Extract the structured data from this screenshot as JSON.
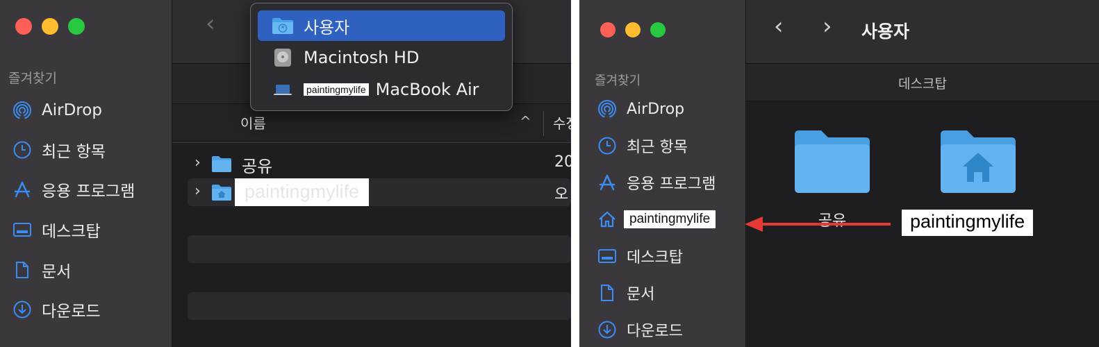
{
  "left": {
    "sidebar": {
      "section_title": "즐겨찾기",
      "items": [
        {
          "label": "AirDrop",
          "icon": "airdrop-icon"
        },
        {
          "label": "최근 항목",
          "icon": "clock-icon"
        },
        {
          "label": "응용 프로그램",
          "icon": "applications-icon"
        },
        {
          "label": "데스크탑",
          "icon": "desktop-icon"
        },
        {
          "label": "문서",
          "icon": "document-icon"
        },
        {
          "label": "다운로드",
          "icon": "download-icon"
        }
      ]
    },
    "toolbar": {
      "back": "‹"
    },
    "path_menu": {
      "items": [
        {
          "label": "사용자",
          "icon": "users-folder-icon",
          "selected": true
        },
        {
          "label": "Macintosh HD",
          "icon": "hard-drive-icon",
          "selected": false
        },
        {
          "label": "MacBook Air",
          "owner_redacted": "paintingmylife",
          "icon": "laptop-icon",
          "selected": false
        }
      ]
    },
    "columns": {
      "name": "이름",
      "sort_indicator": "^",
      "date": "수정일"
    },
    "rows": [
      {
        "expander": "›",
        "name": "공유",
        "modified": "20",
        "icon": "folder-icon"
      },
      {
        "expander": "›",
        "name": "paintingmylife",
        "modified": "오",
        "icon": "home-folder-icon"
      }
    ]
  },
  "right": {
    "toolbar": {
      "back": "‹",
      "forward": "›",
      "title": "사용자"
    },
    "path": "데스크탑",
    "sidebar": {
      "section_title": "즐겨찾기",
      "items": [
        {
          "label": "AirDrop",
          "icon": "airdrop-icon"
        },
        {
          "label": "최근 항목",
          "icon": "clock-icon"
        },
        {
          "label": "응용 프로그램",
          "icon": "applications-icon"
        },
        {
          "label": "paintingmylife",
          "icon": "home-icon"
        },
        {
          "label": "데스크탑",
          "icon": "desktop-icon"
        },
        {
          "label": "문서",
          "icon": "document-icon"
        },
        {
          "label": "다운로드",
          "icon": "download-icon"
        }
      ]
    },
    "grid": [
      {
        "label": "공유",
        "icon": "folder-icon"
      },
      {
        "label": "paintingmylife",
        "icon": "home-folder-icon"
      }
    ]
  },
  "colors": {
    "accent": "#2f62c0",
    "annotation_arrow": "#e53935",
    "sidebar_icon": "#3b8df5"
  }
}
